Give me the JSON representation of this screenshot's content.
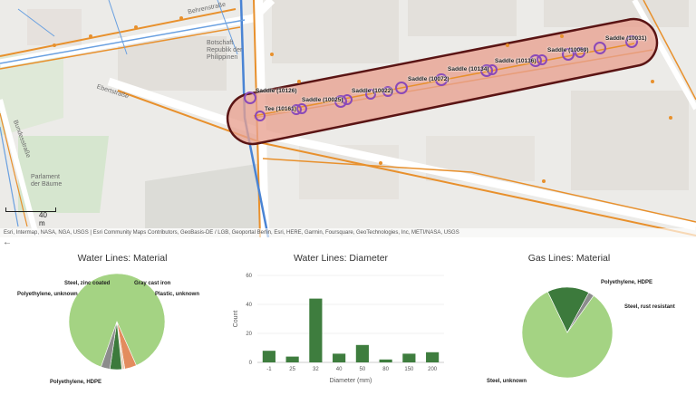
{
  "map": {
    "street_labels": [
      "Behrenstraße",
      "Ebertstraße",
      "Botschaft Republik der Philippinen",
      "Bundesstraße",
      "Parlament der Bäume"
    ],
    "feature_labels": [
      {
        "text": "Saddle (10126)",
        "name": "feature-label-saddle-10126"
      },
      {
        "text": "Tee (10161)",
        "name": "feature-label-tee-10161"
      },
      {
        "text": "Saddle (10025)",
        "name": "feature-label-saddle-10025"
      },
      {
        "text": "Saddle (10022)",
        "name": "feature-label-saddle-10022"
      },
      {
        "text": "Saddle (10072)",
        "name": "feature-label-saddle-10072"
      },
      {
        "text": "Saddle (10134)",
        "name": "feature-label-saddle-10134"
      },
      {
        "text": "Saddle (10136)",
        "name": "feature-label-saddle-10136"
      },
      {
        "text": "Saddle (10069)",
        "name": "feature-label-saddle-10069"
      },
      {
        "text": "Saddle (10031)",
        "name": "feature-label-saddle-10031"
      }
    ],
    "scale_label": "40 m",
    "attribution": "Esri, Intermap, NASA, NGA, USGS | Esri Community Maps Contributors, GeoBasis-DE / LGB, Geoportal Berlin, Esri, HERE, Garmin, Foursquare, GeoTechnologies, Inc, METI/NASA, USGS",
    "colors": {
      "buffer_fill": "#e8a08f",
      "buffer_stroke": "#5a1414",
      "water": "#4a84d4",
      "gas": "#e8902c",
      "selection": "#8a49b8"
    }
  },
  "back_icon": "←",
  "panels": {
    "water_material": {
      "title": "Water Lines: Material",
      "labels": [
        "Steel, zinc coated",
        "Gray cast iron",
        "Polyethylene, unknown",
        "Plastic, unknown",
        "Polyethylene, HDPE"
      ]
    },
    "water_diameter": {
      "title": "Water Lines: Diameter"
    },
    "gas_material": {
      "title": "Gas Lines: Material",
      "labels": [
        "Polyethylene, HDPE",
        "Steel, rust resistant",
        "Steel, unknown"
      ]
    }
  },
  "chart_data": [
    {
      "type": "pie",
      "title": "Water Lines: Material",
      "categories": [
        "Polyethylene, HDPE",
        "Polyethylene, unknown",
        "Steel, zinc coated",
        "Gray cast iron",
        "Plastic, unknown"
      ],
      "values": [
        88,
        4,
        1,
        4,
        3
      ],
      "colors": [
        "#a4d383",
        "#e38c5e",
        "#e8d0b8",
        "#3c7a3c",
        "#8c8c8c"
      ]
    },
    {
      "type": "bar",
      "title": "Water Lines: Diameter",
      "categories": [
        "-1",
        "25",
        "32",
        "40",
        "50",
        "80",
        "150",
        "200"
      ],
      "values": [
        8,
        4,
        44,
        6,
        12,
        2,
        6,
        7
      ],
      "xlabel": "Diameter (mm)",
      "ylabel": "Count",
      "ylim": [
        0,
        60
      ],
      "yticks": [
        0,
        20,
        40,
        60
      ],
      "color": "#3e7d3e"
    },
    {
      "type": "pie",
      "title": "Gas Lines: Material",
      "categories": [
        "Steel, unknown",
        "Polyethylene, HDPE",
        "Steel, rust resistant"
      ],
      "values": [
        83,
        15,
        2
      ],
      "colors": [
        "#a4d383",
        "#3c7a3c",
        "#8c8c8c"
      ]
    }
  ]
}
